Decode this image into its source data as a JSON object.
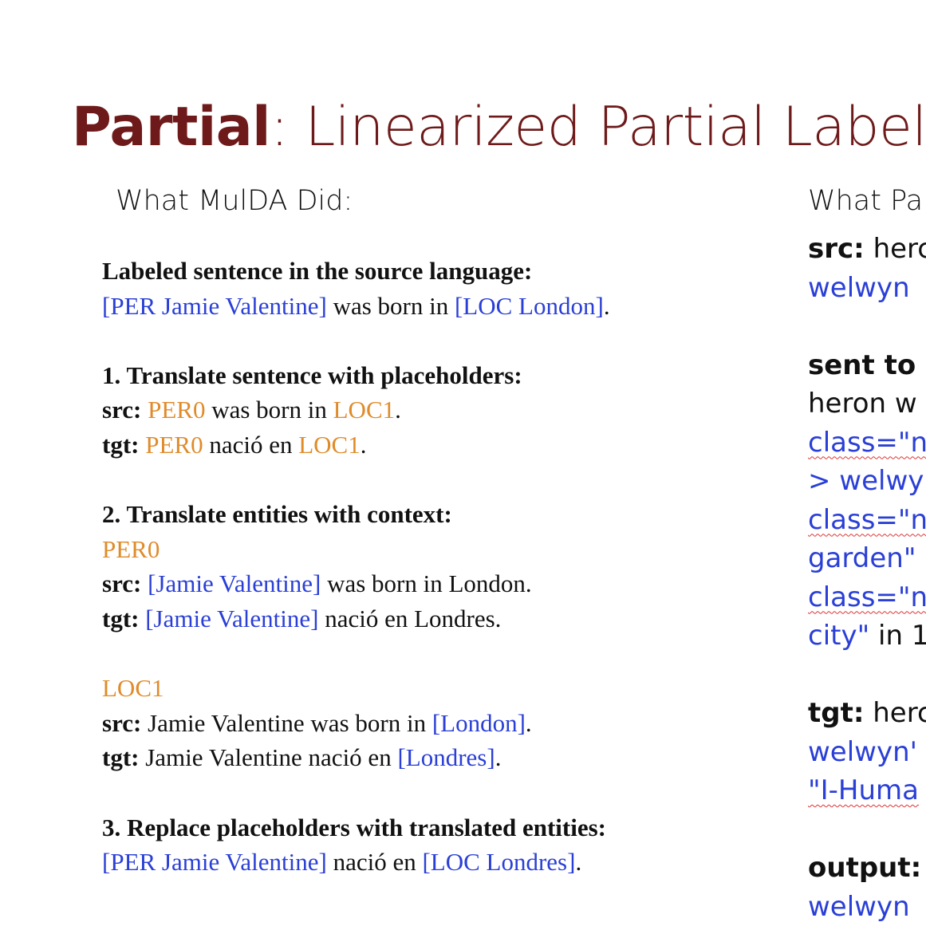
{
  "title": {
    "strong": "Partial",
    "rest": ": Linearized Partial Labele"
  },
  "left": {
    "heading": "What MulDA Did:",
    "labeled_sentence": {
      "heading": "Labeled sentence in the source language:",
      "ent1": "[PER Jamie Valentine]",
      "mid": " was born in ",
      "ent2": "[LOC London]",
      "end": "."
    },
    "step1": {
      "heading": "1. Translate sentence with placeholders:",
      "src_label": "src:",
      "src_p1": "PER0",
      "src_mid": " was born in ",
      "src_p2": "LOC1",
      "src_end": ".",
      "tgt_label": "tgt:",
      "tgt_p1": "PER0",
      "tgt_mid": " nació en ",
      "tgt_p2": "LOC1",
      "tgt_end": "."
    },
    "step2": {
      "heading": "2. Translate entities with context:",
      "per": {
        "placeholder": "PER0",
        "src_label": "src:",
        "src_ent": "[Jamie Valentine]",
        "src_rest": " was born in London.",
        "tgt_label": "tgt:",
        "tgt_ent": "[Jamie Valentine]",
        "tgt_rest": " nació en Londres."
      },
      "loc": {
        "placeholder": "LOC1",
        "src_label": "src:",
        "src_pre": " Jamie Valentine was born in ",
        "src_ent": "[London]",
        "src_end": ".",
        "tgt_label": "tgt:",
        "tgt_pre": " Jamie Valentine nació en ",
        "tgt_ent": "[Londres]",
        "tgt_end": "."
      }
    },
    "step3": {
      "heading": "3. Replace placeholders with translated entities:",
      "ent1": "[PER Jamie Valentine]",
      "mid": " nació en ",
      "ent2": "[LOC Londres]",
      "end": "."
    }
  },
  "right": {
    "heading": "What Pa",
    "src_label": "src:",
    "src_text": " herc",
    "src_line2": "welwyn",
    "sent_label": "sent to (",
    "sent_line1": "heron w",
    "sent_line2": "class=\"n",
    "sent_line3": "> welwy",
    "sent_line4": "class=\"n",
    "sent_line5": "garden\"",
    "sent_line6": "class=\"n",
    "sent_line7a": "city\"",
    "sent_line7b": " in 1",
    "tgt_label": "tgt:",
    "tgt_text": " herc",
    "tgt_line2": "welwyn'",
    "tgt_line3": "\"I-Huma",
    "output_label": "output:",
    "output_line2": "welwyn"
  }
}
